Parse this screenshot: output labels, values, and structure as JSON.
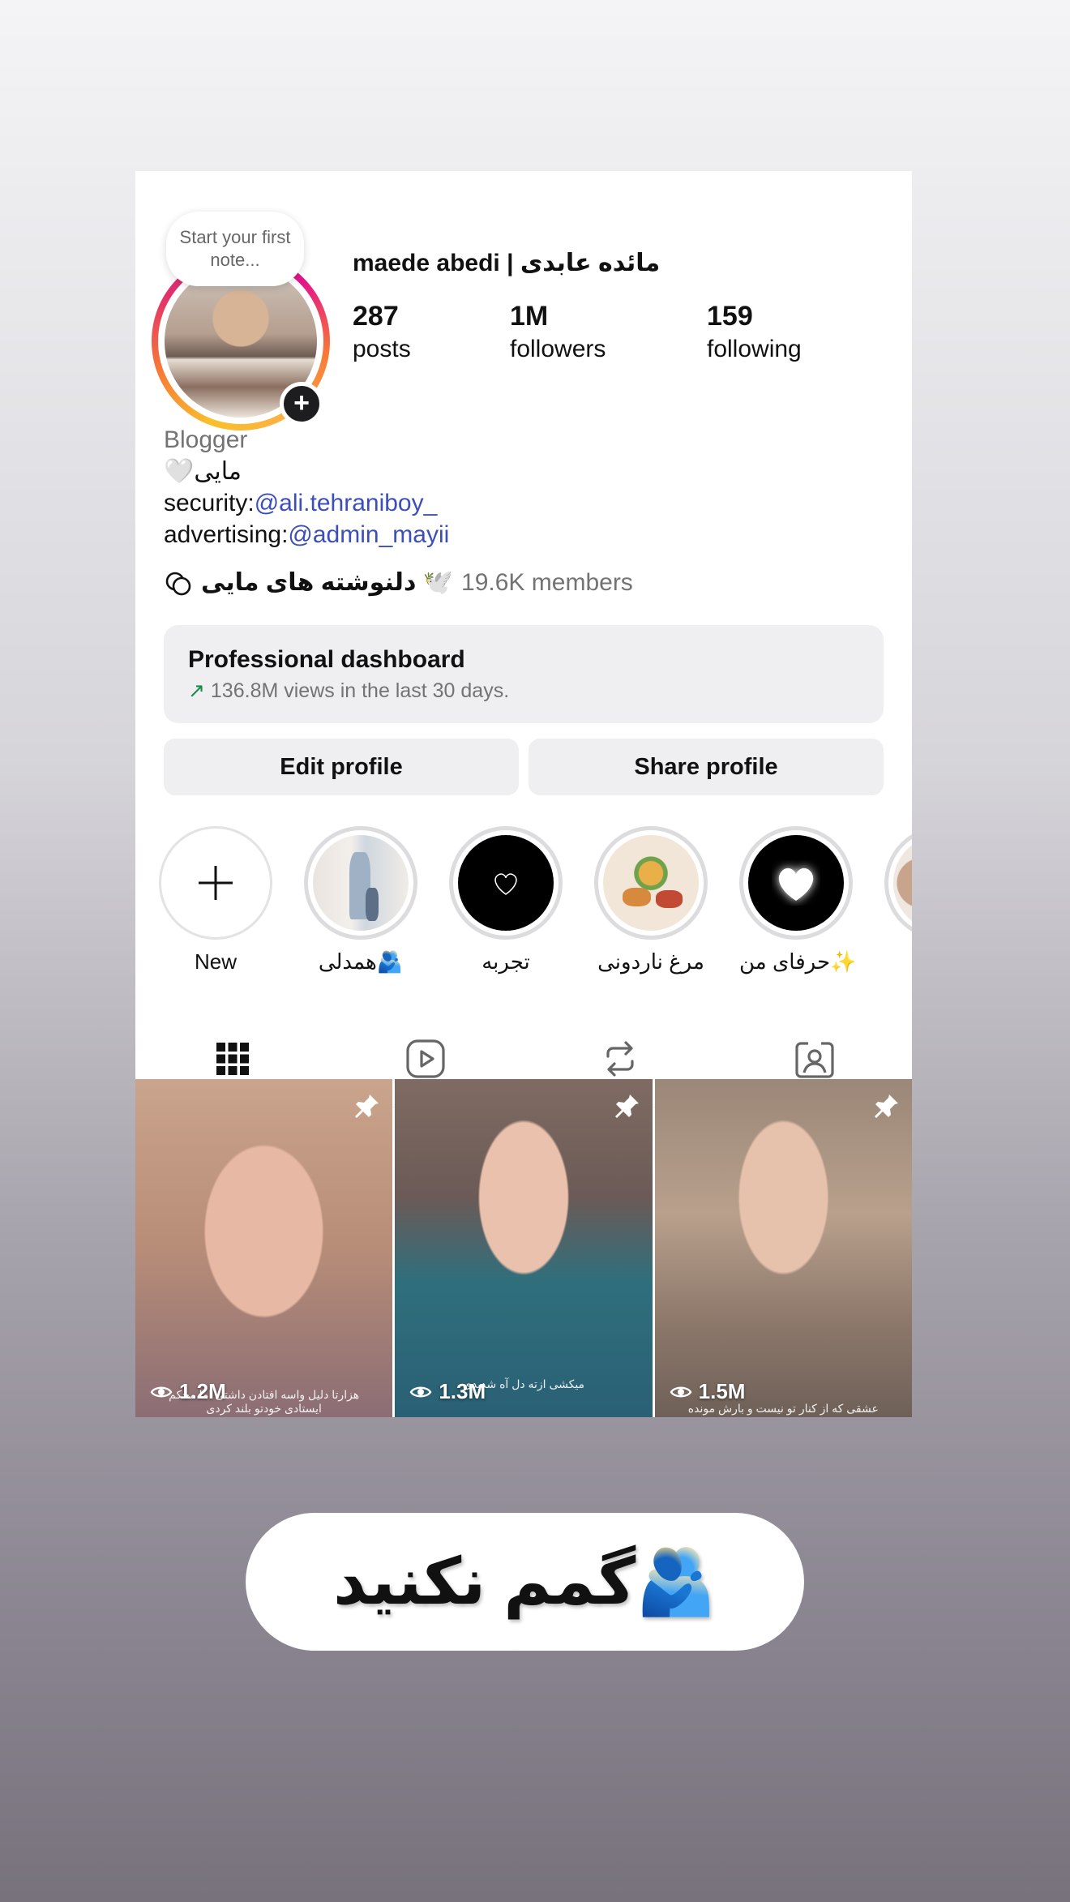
{
  "note": {
    "text": "Start your first note..."
  },
  "profile": {
    "name": "maede abedi | مائده عابدی",
    "stats": [
      {
        "value": "287",
        "label": "posts"
      },
      {
        "value": "1M",
        "label": "followers"
      },
      {
        "value": "159",
        "label": "following"
      }
    ],
    "bio": {
      "category": "Blogger",
      "line1": "🤍مایی",
      "security_prefix": "security:",
      "security_handle": "@ali.tehraniboy_",
      "advertising_prefix": "advertising:",
      "advertising_handle": "@admin_mayii"
    },
    "channel": {
      "name": "دلنوشته های مایی 🕊️",
      "members": "19.6K members"
    }
  },
  "dashboard": {
    "title": "Professional dashboard",
    "arrow": "↗",
    "subtitle": "136.8M views in the last 30 days."
  },
  "buttons": {
    "edit": "Edit profile",
    "share": "Share profile"
  },
  "highlights": [
    {
      "label": "New"
    },
    {
      "label": "همدلی🫂"
    },
    {
      "label": "تجربه"
    },
    {
      "label": "مرغ ناردونی"
    },
    {
      "label": "حرفای من✨"
    }
  ],
  "posts": [
    {
      "views": "1.2M",
      "caption": "هزارتا دلیل واسه افتادن داشتی اما محکم ایستادی خودتو بلند کردی"
    },
    {
      "views": "1.3M",
      "caption": "میکشی ازته دل آه شدیدی"
    },
    {
      "views": "1.5M",
      "caption": "عشقی که از کنار تو نیست و بارش مونده"
    }
  ],
  "overlay": {
    "text": "گمم نکنید🫂"
  },
  "colors": {
    "link": "#3c4fb8",
    "trend": "#1a8a4a",
    "muted": "#737373"
  }
}
